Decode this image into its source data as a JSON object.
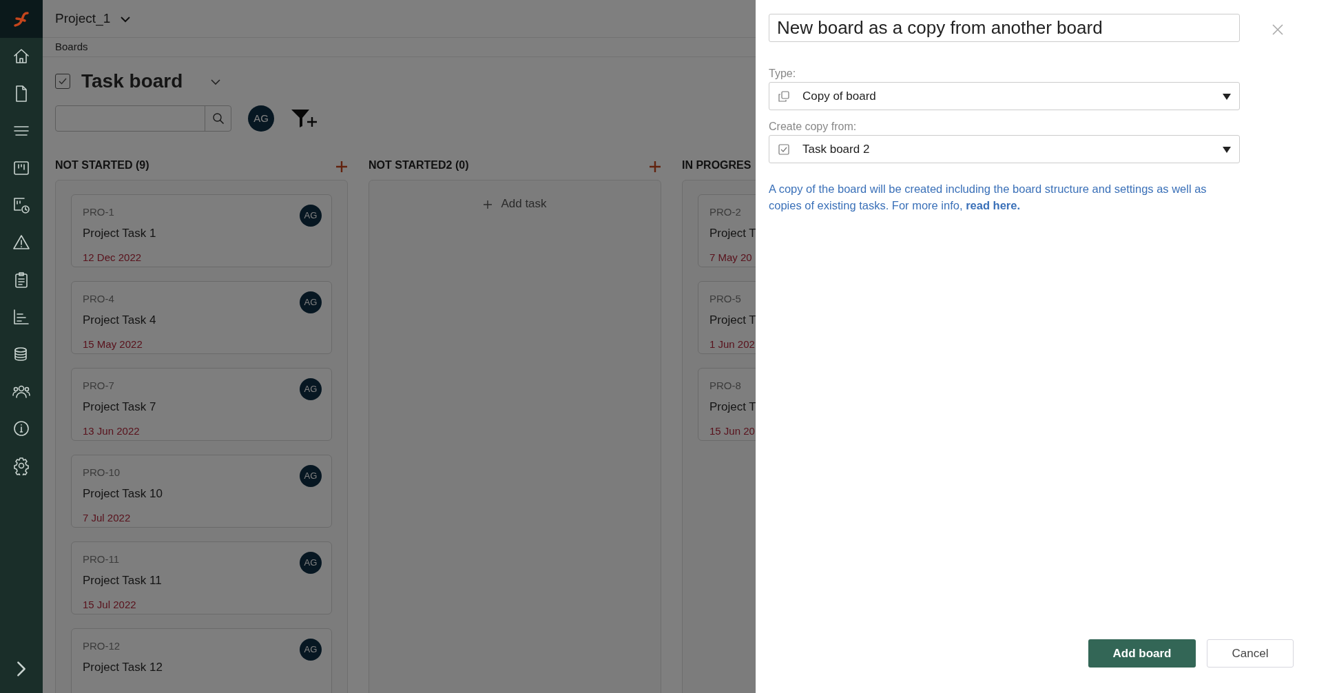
{
  "header": {
    "project": "Project_1",
    "breadcrumb": "Boards"
  },
  "board": {
    "title": "Task board",
    "avatar": "AG"
  },
  "columns": [
    {
      "title": "NOT STARTED (9)",
      "add_button": true,
      "cards": [
        {
          "id": "PRO-1",
          "title": "Project Task 1",
          "due": "12 Dec 2022",
          "assignee": "AG"
        },
        {
          "id": "PRO-4",
          "title": "Project Task 4",
          "due": "15 May 2022",
          "assignee": "AG"
        },
        {
          "id": "PRO-7",
          "title": "Project Task 7",
          "due": "13 Jun 2022",
          "assignee": "AG"
        },
        {
          "id": "PRO-10",
          "title": "Project Task 10",
          "due": "7 Jul 2022",
          "assignee": "AG"
        },
        {
          "id": "PRO-11",
          "title": "Project Task 11",
          "due": "15 Jul 2022",
          "assignee": "AG"
        },
        {
          "id": "PRO-12",
          "title": "Project Task 12",
          "assignee": "AG"
        }
      ]
    },
    {
      "title": "NOT STARTED2 (0)",
      "add_button": true,
      "add_task": "Add task"
    },
    {
      "title": "IN PROGRES",
      "add_button": false,
      "cards": [
        {
          "id": "PRO-2",
          "title": "Project T",
          "due": "7 May 20"
        },
        {
          "id": "PRO-5",
          "title": "Project T",
          "due": "1 Jun 202"
        },
        {
          "id": "PRO-8",
          "title": "Project T",
          "due": "15 Jun 20"
        }
      ]
    }
  ],
  "dialog": {
    "title": "New board as a copy from another board",
    "fields": [
      {
        "label": "Type:",
        "value": "Copy of board",
        "kind": "copy"
      },
      {
        "label": "Create copy from:",
        "value": "Task board 2",
        "kind": "board"
      }
    ],
    "info": "A copy of the board will be created including the board structure and settings as well as copies of existing tasks. For more info,",
    "link": "read here.",
    "buttons": [
      {
        "label": "Add board",
        "kind": "primary"
      },
      {
        "label": "Cancel",
        "kind": "secondary"
      }
    ]
  }
}
